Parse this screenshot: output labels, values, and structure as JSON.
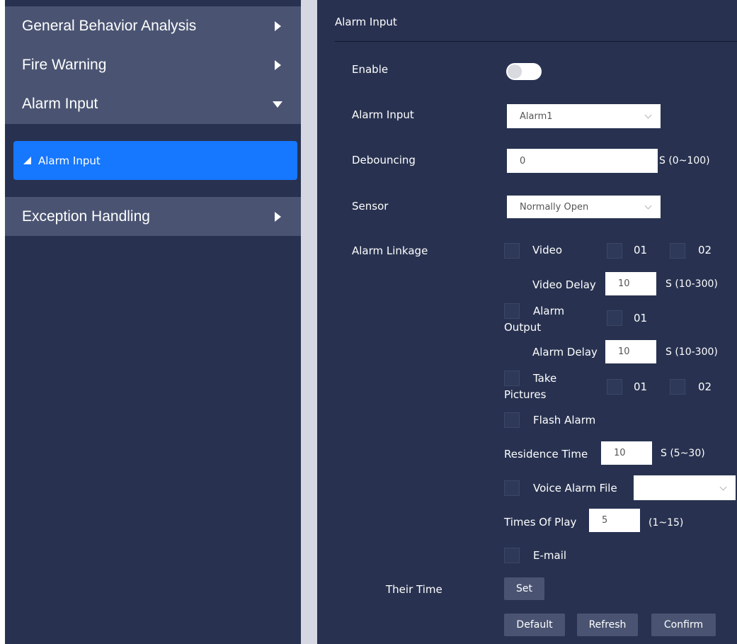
{
  "sidebar": {
    "items": [
      {
        "label": "General Behavior Analysis"
      },
      {
        "label": "Fire Warning"
      },
      {
        "label": "Alarm Input"
      },
      {
        "label": "Exception Handling"
      }
    ],
    "sub_item": "Alarm Input"
  },
  "main": {
    "title": "Alarm Input",
    "enable_label": "Enable",
    "alarm_input_label": "Alarm Input",
    "alarm_input_value": "Alarm1",
    "debouncing_label": "Debouncing",
    "debouncing_value": "0",
    "debouncing_unit": "S (0~100)",
    "sensor_label": "Sensor",
    "sensor_value": "Normally Open",
    "linkage_label": "Alarm Linkage",
    "video_label": "Video",
    "ch_01": "01",
    "ch_02": "02",
    "video_delay_label": "Video Delay",
    "video_delay_value": "10",
    "video_delay_unit": "S  (10-300)",
    "alarm_output_line1": "Alarm",
    "alarm_output_line2": "Output",
    "alarm_delay_label": "Alarm Delay",
    "alarm_delay_value": "10",
    "alarm_delay_unit": "S  (10-300)",
    "take_pictures_line1": "Take",
    "take_pictures_line2": "Pictures",
    "flash_alarm_label": "Flash Alarm",
    "residence_label": "Residence Time",
    "residence_value": "10",
    "residence_unit": "S (5~30)",
    "voice_alarm_label": "Voice Alarm File",
    "times_label": "Times Of Play",
    "times_value": "5",
    "times_unit": "(1~15)",
    "email_label": "E-mail",
    "their_time_label": "Their Time",
    "set_button": "Set",
    "default_button": "Default",
    "refresh_button": "Refresh",
    "confirm_button": "Confirm"
  },
  "colors": {
    "panel_bg": "#283250",
    "menu_bg": "#4a5472",
    "accent": "#1677ff",
    "gap": "#d5d8e2"
  }
}
